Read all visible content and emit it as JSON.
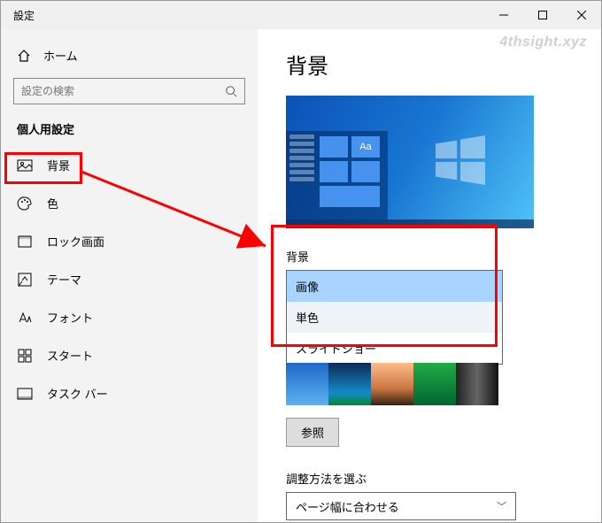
{
  "window": {
    "title": "設定"
  },
  "watermark": "4thsight.xyz",
  "sidebar": {
    "home": "ホーム",
    "search_placeholder": "設定の検索",
    "section": "個人用設定",
    "items": [
      {
        "label": "背景"
      },
      {
        "label": "色"
      },
      {
        "label": "ロック画面"
      },
      {
        "label": "テーマ"
      },
      {
        "label": "フォント"
      },
      {
        "label": "スタート"
      },
      {
        "label": "タスク バー"
      }
    ]
  },
  "page": {
    "title": "背景",
    "preview_sample": "Aa",
    "bg_label": "背景",
    "bg_options": [
      "画像",
      "単色",
      "スライドショー"
    ],
    "browse": "参照",
    "fit_label": "調整方法を選ぶ",
    "fit_value": "ページ幅に合わせる"
  }
}
